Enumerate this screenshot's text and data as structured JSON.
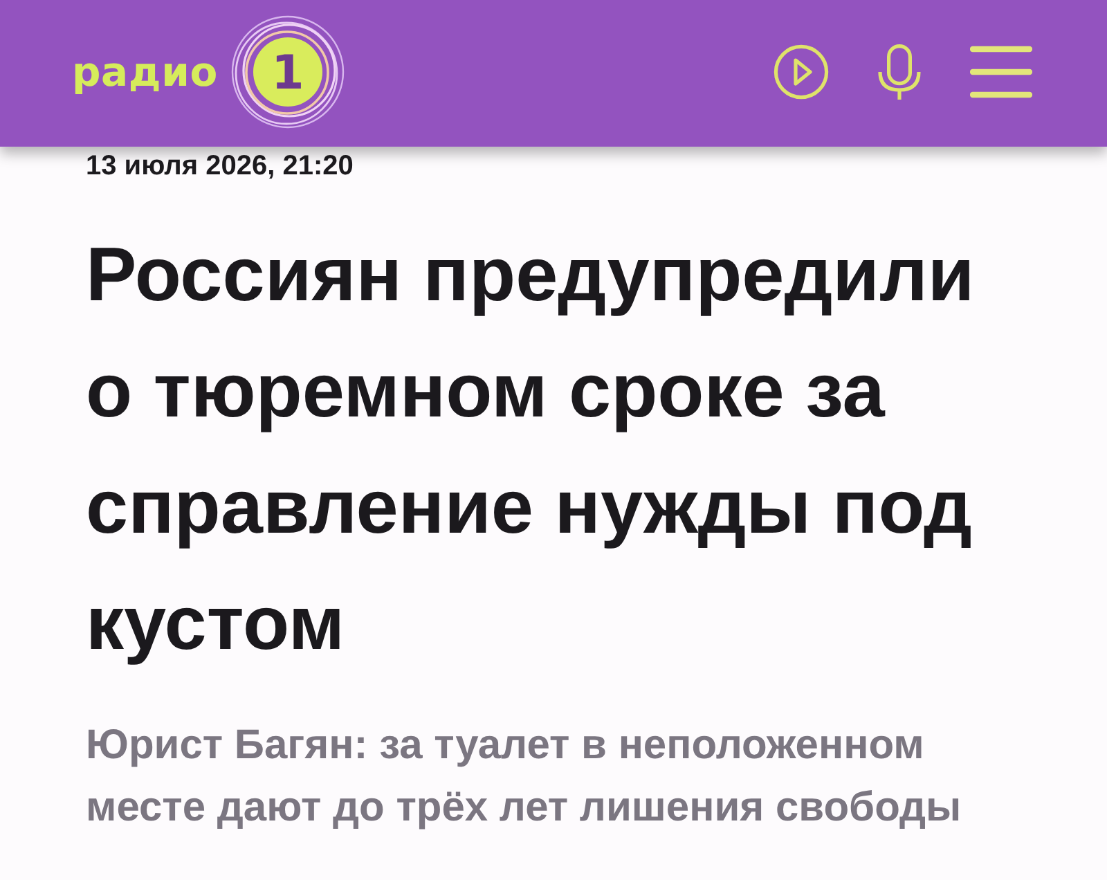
{
  "header": {
    "logo": {
      "wordmark": "радио",
      "badge": "1"
    }
  },
  "article": {
    "date": "13 июля 2026, 21:20",
    "title": "Россиян предупредили о тюремном сроке за справление нужды под кустом",
    "subtitle": "Юрист Багян: за туалет в неположенном месте дают до трёх лет лишения свободы"
  }
}
